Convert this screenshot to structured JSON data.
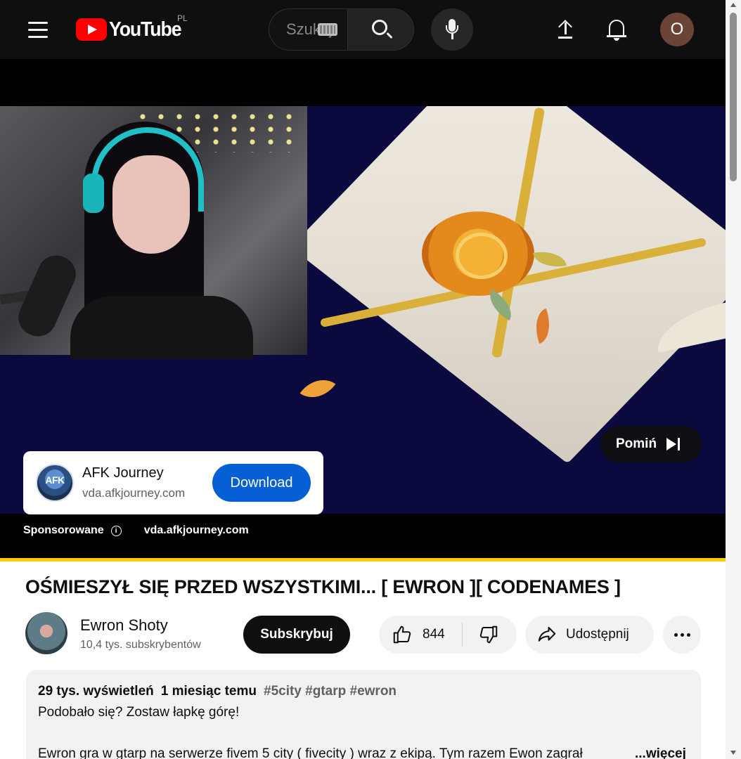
{
  "header": {
    "logo_text": "YouTube",
    "country_code": "PL",
    "search_placeholder": "Szukaj"
  },
  "header_icons": [
    "menu-icon",
    "youtube-logo",
    "keyboard-icon",
    "search-icon",
    "mic-icon",
    "upload-icon",
    "bell-icon"
  ],
  "user": {
    "avatar_initial": "O",
    "avatar_color": "#6b4337"
  },
  "ad": {
    "skip_label": "Pomiń",
    "advertiser_logo_text": "AFK",
    "title": "AFK Journey",
    "url": "vda.afkjourney.com",
    "cta_label": "Download",
    "cta_color": "#065fd4",
    "sponsored_label": "Sponsorowane",
    "footer_url": "vda.afkjourney.com",
    "progress_color": "#ffcc00"
  },
  "video": {
    "title": "OŚMIESZYŁ SIĘ PRZED WSZYSTKIMI... [ EWRON ][ CODENAMES ]",
    "channel_name": "Ewron Shoty",
    "subscribers": "10,4 tys. subskrybentów",
    "subscribe_label": "Subskrybuj",
    "likes": "844",
    "share_label": "Udostępnij"
  },
  "description": {
    "views": "29 tys. wyświetleń",
    "date": "1 miesiąc temu",
    "tags": [
      "#5city",
      "#gtarp",
      "#ewron"
    ],
    "line1": "Podobało się? Zostaw łapkę górę!",
    "line2": "Ewron gra w gtarp na serwerze fivem 5 city ( fivecity ) wraz z ekipą. Tym razem Ewon zagrał",
    "more_label": "...więcej"
  }
}
